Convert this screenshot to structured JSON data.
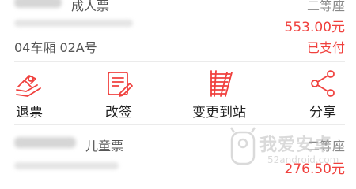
{
  "ticket1": {
    "type": "成人票",
    "seat_class": "二等座",
    "price": "553.00元",
    "seat": "04车厢 02A号",
    "status": "已支付"
  },
  "actions": [
    {
      "label": "退票",
      "icon": "refund-icon"
    },
    {
      "label": "改签",
      "icon": "change-ticket-icon"
    },
    {
      "label": "变更到站",
      "icon": "change-destination-icon"
    },
    {
      "label": "分享",
      "icon": "share-icon"
    }
  ],
  "ticket2": {
    "type": "儿童票",
    "seat_class": "二等座",
    "price": "276.50元"
  },
  "watermark": {
    "text": "我爱安卓",
    "domain": "52android.com"
  },
  "colors": {
    "accent": "#f0413e",
    "text": "#555555"
  }
}
